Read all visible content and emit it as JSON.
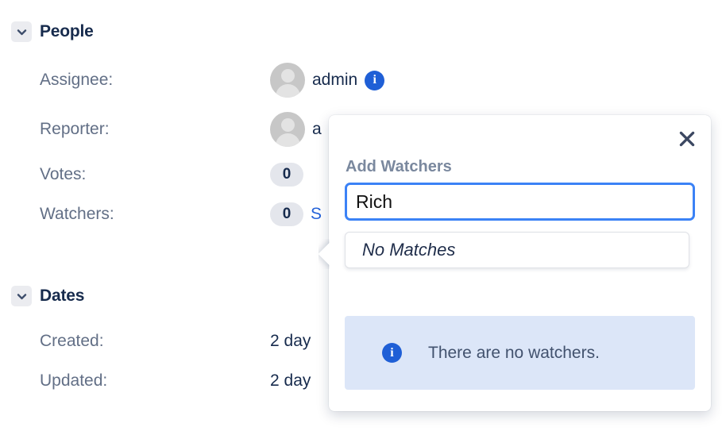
{
  "sections": [
    {
      "id": "people",
      "title": "People",
      "chevron_icon": "chevron-down-icon",
      "fields": [
        {
          "label": "Assignee:",
          "value": "admin",
          "avatar": true,
          "info_icon": "info-icon",
          "badge": null,
          "link": null
        },
        {
          "label": "Reporter:",
          "value": "a",
          "avatar": true,
          "info_icon": null,
          "badge": null,
          "link": null
        },
        {
          "label": "Votes:",
          "value": null,
          "avatar": false,
          "info_icon": null,
          "badge": "0",
          "link": null
        },
        {
          "label": "Watchers:",
          "value": null,
          "avatar": false,
          "info_icon": null,
          "badge": "0",
          "link": "S"
        }
      ]
    },
    {
      "id": "dates",
      "title": "Dates",
      "chevron_icon": "chevron-down-icon",
      "fields": [
        {
          "label": "Created:",
          "value": "2 day",
          "avatar": false,
          "info_icon": null,
          "badge": null,
          "link": null
        },
        {
          "label": "Updated:",
          "value": "2 day",
          "avatar": false,
          "info_icon": null,
          "badge": null,
          "link": null
        }
      ]
    }
  ],
  "popup": {
    "title": "Add Watchers",
    "close_icon": "close-icon",
    "input": {
      "value": "Rich",
      "placeholder": ""
    },
    "dropdown": {
      "options": [
        "No Matches"
      ]
    },
    "banner": {
      "icon": "info-icon",
      "message": "There are no watchers."
    }
  },
  "colors": {
    "accent_blue": "#1f5fd6",
    "focus_blue": "#3b82f6",
    "link_blue": "#2563d9",
    "text_dark": "#172b4d",
    "text_muted": "#626f86",
    "label_muted": "#7a889e",
    "badge_bg": "#e4e6ec",
    "banner_bg": "#dce6f8",
    "chevron_bg": "#ebecf0"
  }
}
